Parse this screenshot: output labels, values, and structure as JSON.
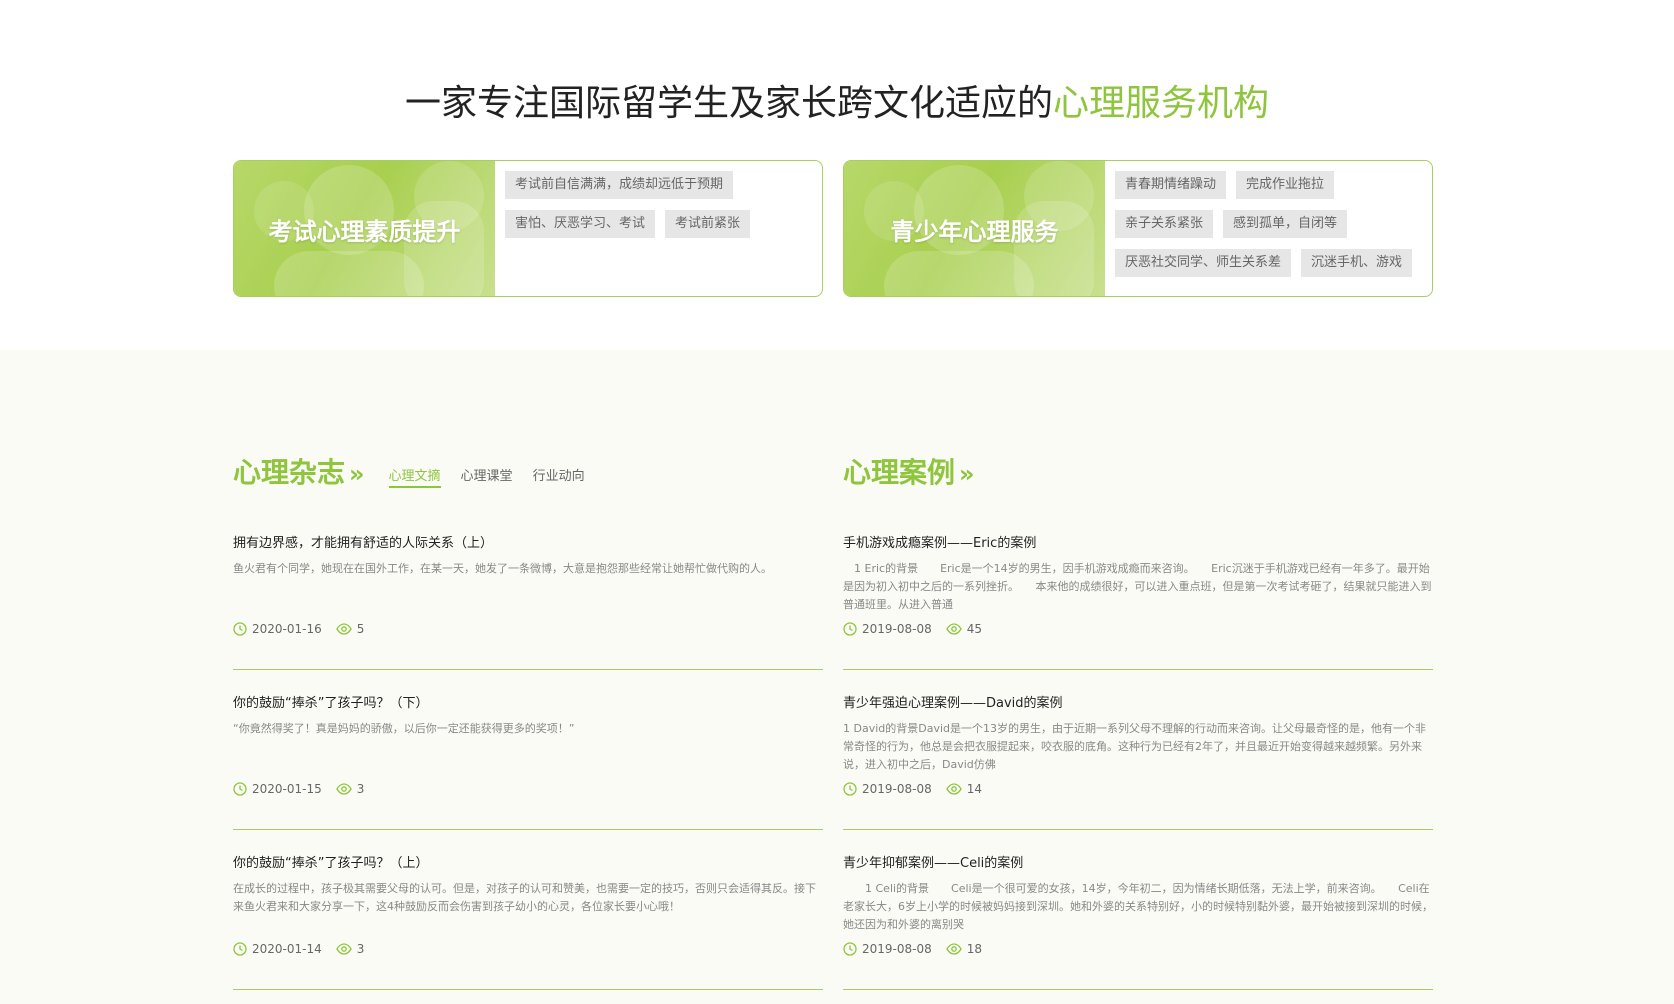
{
  "headline": {
    "prefix": "一家专注国际留学生及家长跨文化适应的",
    "accent": "心理服务机构"
  },
  "cards": {
    "left": {
      "title": "考试心理素质提升",
      "tags": [
        "考试前自信满满，成绩却远低于预期",
        "害怕、厌恶学习、考试",
        "考试前紧张"
      ]
    },
    "right": {
      "title": "青少年心理服务",
      "tags": [
        "青春期情绪躁动",
        "完成作业拖拉",
        "亲子关系紧张",
        "感到孤单，自闭等",
        "厌恶社交同学、师生关系差",
        "沉迷手机、游戏"
      ]
    }
  },
  "magazine": {
    "title": "心理杂志",
    "chevron": "»",
    "tabs": [
      "心理文摘",
      "心理课堂",
      "行业动向"
    ],
    "active_tab": "心理文摘",
    "articles": [
      {
        "title": "拥有边界感，才能拥有舒适的人际关系（上）",
        "desc": "鱼火君有个同学，她现在在国外工作，在某一天，她发了一条微博，大意是抱怨那些经常让她帮忙做代购的人。",
        "date": "2020-01-16",
        "views": "5"
      },
      {
        "title": "你的鼓励“捧杀”了孩子吗？（下）",
        "desc": "“你竟然得奖了！真是妈妈的骄傲，以后你一定还能获得更多的奖项！”",
        "date": "2020-01-15",
        "views": "3"
      },
      {
        "title": "你的鼓励“捧杀”了孩子吗？（上）",
        "desc": "在成长的过程中，孩子极其需要父母的认可。但是，对孩子的认可和赞美，也需要一定的技巧，否则只会适得其反。接下来鱼火君来和大家分享一下，这4种鼓励反而会伤害到孩子幼小的心灵，各位家长要小心哦！",
        "date": "2020-01-14",
        "views": "3"
      }
    ]
  },
  "cases": {
    "title": "心理案例",
    "chevron": "»",
    "articles": [
      {
        "title": "手机游戏成瘾案例——Eric的案例",
        "desc": "　1 Eric的背景　　Eric是一个14岁的男生，因手机游戏成瘾而来咨询。　　Eric沉迷于手机游戏已经有一年多了。最开始是因为初入初中之后的一系列挫折。　　本来他的成绩很好，可以进入重点班，但是第一次考试考砸了，结果就只能进入到普通班里。从进入普通",
        "date": "2019-08-08",
        "views": "45"
      },
      {
        "title": "青少年强迫心理案例——David的案例",
        "desc": "1 David的背景David是一个13岁的男生，由于近期一系列父母不理解的行动而来咨询。让父母最奇怪的是，他有一个非常奇怪的行为，他总是会把衣服提起来，咬衣服的底角。这种行为已经有2年了，并且最近开始变得越来越频繁。另外来说，进入初中之后，David仿佛",
        "date": "2019-08-08",
        "views": "14"
      },
      {
        "title": "青少年抑郁案例——Celi的案例",
        "desc": "　　1 Celi的背景　　Celi是一个很可爱的女孩，14岁，今年初二，因为情绪长期低落，无法上学，前来咨询。　　Celi在老家长大，6岁上小学的时候被妈妈接到深圳。她和外婆的关系特别好，小的时候特别黏外婆，最开始被接到深圳的时候，她还因为和外婆的离别哭",
        "date": "2019-08-08",
        "views": "18"
      }
    ]
  },
  "colors": {
    "accent": "#8ec53d",
    "border": "#a6cf5e",
    "tag_bg": "#e6e6e6"
  },
  "icons": {
    "date": "clock-icon",
    "views": "eye-icon"
  }
}
